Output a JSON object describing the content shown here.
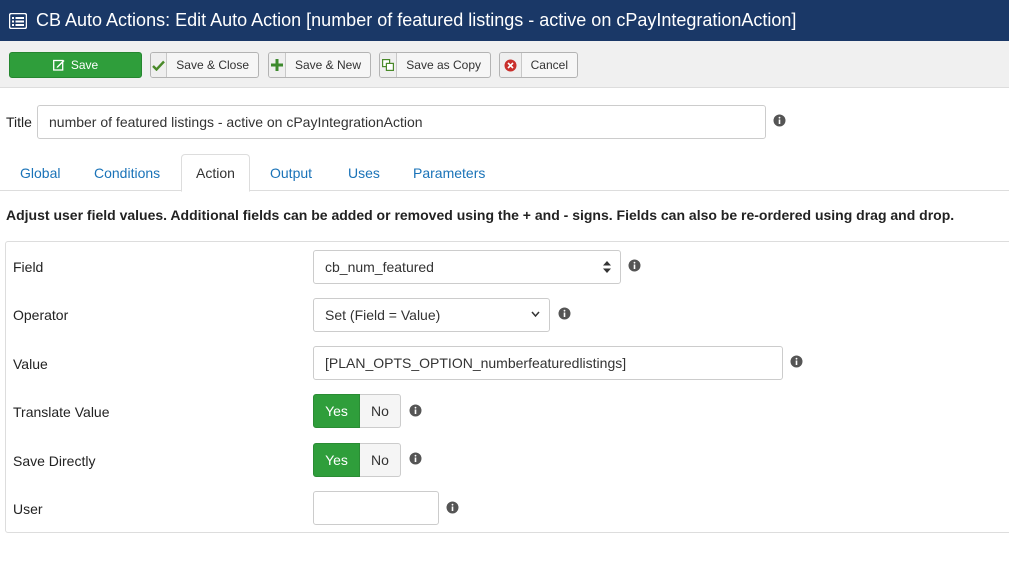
{
  "header": {
    "title": "CB Auto Actions: Edit Auto Action [number of featured listings - active on cPayIntegrationAction]",
    "icon": "list-icon"
  },
  "toolbar": {
    "save": "Save",
    "save_close": "Save & Close",
    "save_new": "Save & New",
    "save_copy": "Save as Copy",
    "cancel": "Cancel"
  },
  "title_field": {
    "label": "Title",
    "value": "number of featured listings - active on cPayIntegrationAction"
  },
  "tabs": [
    "Global",
    "Conditions",
    "Action",
    "Output",
    "Uses",
    "Parameters"
  ],
  "active_tab": "Action",
  "description": "Adjust user field values. Additional fields can be added or removed using the + and - signs. Fields can also be re-ordered using drag and drop.",
  "form": {
    "field": {
      "label": "Field",
      "value": "cb_num_featured"
    },
    "operator": {
      "label": "Operator",
      "value": "Set (Field = Value)"
    },
    "value": {
      "label": "Value",
      "value": "[PLAN_OPTS_OPTION_numberfeaturedlistings]"
    },
    "translate": {
      "label": "Translate Value",
      "yes": "Yes",
      "no": "No",
      "selected": "Yes"
    },
    "save_directly": {
      "label": "Save Directly",
      "yes": "Yes",
      "no": "No",
      "selected": "Yes"
    },
    "user": {
      "label": "User",
      "value": ""
    }
  },
  "colors": {
    "header_bg": "#1a3867",
    "save_green": "#2f9e3b",
    "link_blue": "#1a73b8"
  }
}
